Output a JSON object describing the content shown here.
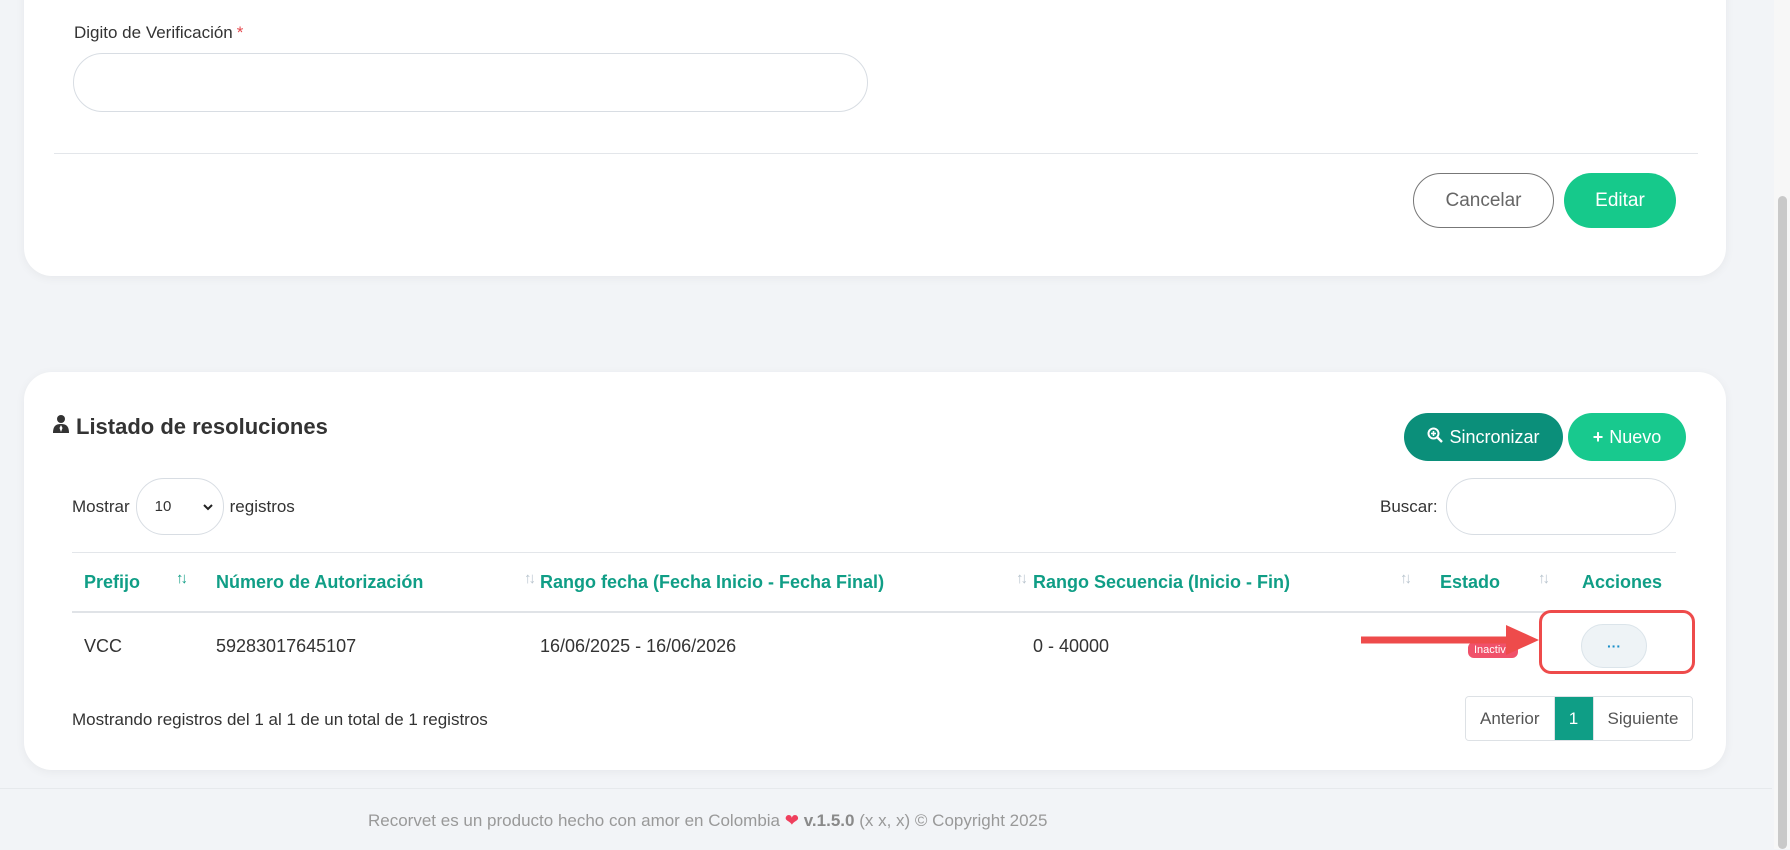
{
  "form": {
    "dv_label": "Digito de Verificación",
    "required_mark": "*",
    "dv_value": "",
    "cancel_label": "Cancelar",
    "edit_label": "Editar"
  },
  "list": {
    "title": "Listado de resoluciones",
    "sync_label": "Sincronizar",
    "new_label": "Nuevo",
    "show_label": "Mostrar",
    "page_size": "10",
    "records_label": "registros",
    "search_label": "Buscar:",
    "search_value": "",
    "columns": {
      "c0": "Prefijo",
      "c1": "Número de Autorización",
      "c2": "Rango fecha (Fecha Inicio - Fecha Final)",
      "c3": "Rango Secuencia (Inicio - Fin)",
      "c4": "Estado",
      "c5": "Acciones"
    },
    "rows": [
      {
        "prefix": "VCC",
        "auth_number": "59283017645107",
        "date_range": "16/06/2025 - 16/06/2026",
        "seq_range": "0 - 40000",
        "status": "Inactivo",
        "actions": "···"
      }
    ],
    "info": "Mostrando registros del 1 al 1 de un total de 1 registros",
    "pager": {
      "prev": "Anterior",
      "current": "1",
      "next": "Siguiente"
    }
  },
  "footer": {
    "text": "Recorvet es un producto hecho con amor en Colombia",
    "heart": "❤",
    "version": "v.1.5.0",
    "tail": "(x x, x) © Copyright 2025"
  },
  "colors": {
    "accent": "#16c98b",
    "accent_dark": "#0b8f7a",
    "header_text": "#109e86",
    "badge_inactive": "#f0516a",
    "highlight": "#ee4b4b"
  },
  "icons": {
    "title_icon": "user-tie-icon",
    "sync_icon": "search-plus-icon",
    "new_icon": "plus-icon",
    "select_icon": "chevron-down-icon"
  }
}
